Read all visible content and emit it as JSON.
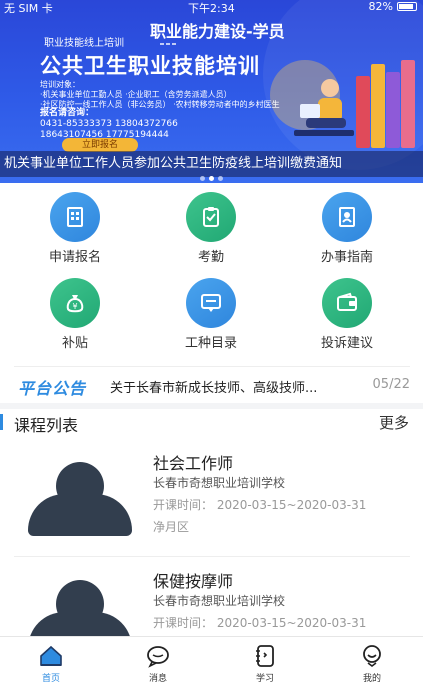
{
  "status_bar": {
    "carrier": "无 SIM 卡",
    "time": "下午2:34",
    "battery": "82%"
  },
  "banner": {
    "headline": "职业能力建设-学员",
    "subtitle": "职业技能线上培训",
    "title": "公共卫生职业技能培训",
    "target_label": "培训对象：",
    "target_lines": [
      "·机关事业单位工勤人员        ·企业职工（含劳务派遣人员）",
      "·社区防控一线工作人员（非公务员）  ·农村转移劳动者中的乡村医生"
    ],
    "tel_label": "报名请咨询：",
    "tel_lines": [
      "0431-85333373    13804372766",
      "18643107456      17775194444"
    ],
    "button_label": "立即报名",
    "notice": "机关事业单位工作人员参加公共卫生防疫线上培训缴费通知",
    "colors": {
      "bg": "#2f5be8",
      "button": "#f3b637"
    }
  },
  "menu": {
    "items": [
      {
        "label": "申请报名",
        "icon": "building-icon",
        "color": "blue"
      },
      {
        "label": "考勤",
        "icon": "clipboard-icon",
        "color": "green"
      },
      {
        "label": "办事指南",
        "icon": "guide-book-icon",
        "color": "blue"
      },
      {
        "label": "补贴",
        "icon": "money-bag-icon",
        "color": "green"
      },
      {
        "label": "工种目录",
        "icon": "chat-window-icon",
        "color": "blue"
      },
      {
        "label": "投诉建议",
        "icon": "wallet-icon",
        "color": "green"
      }
    ]
  },
  "announcement": {
    "logo": "平台公告",
    "text": "关于长春市新成长技师、高级技师...",
    "date": "05/22"
  },
  "courses": {
    "title": "课程列表",
    "more": "更多",
    "items": [
      {
        "name": "社会工作师",
        "school": "长春市奇想职业培训学校",
        "time": "开课时间：  2020-03-15~2020-03-31",
        "area": "净月区"
      },
      {
        "name": "保健按摩师",
        "school": "长春市奇想职业培训学校",
        "time": "开课时间：  2020-03-15~2020-03-31",
        "area": ""
      }
    ]
  },
  "tabbar": {
    "items": [
      {
        "label": "首页",
        "icon": "home-icon",
        "active": true
      },
      {
        "label": "消息",
        "icon": "message-icon",
        "active": false
      },
      {
        "label": "学习",
        "icon": "study-icon",
        "active": false
      },
      {
        "label": "我的",
        "icon": "profile-icon",
        "active": false
      }
    ],
    "accent": "#2e8be0"
  }
}
